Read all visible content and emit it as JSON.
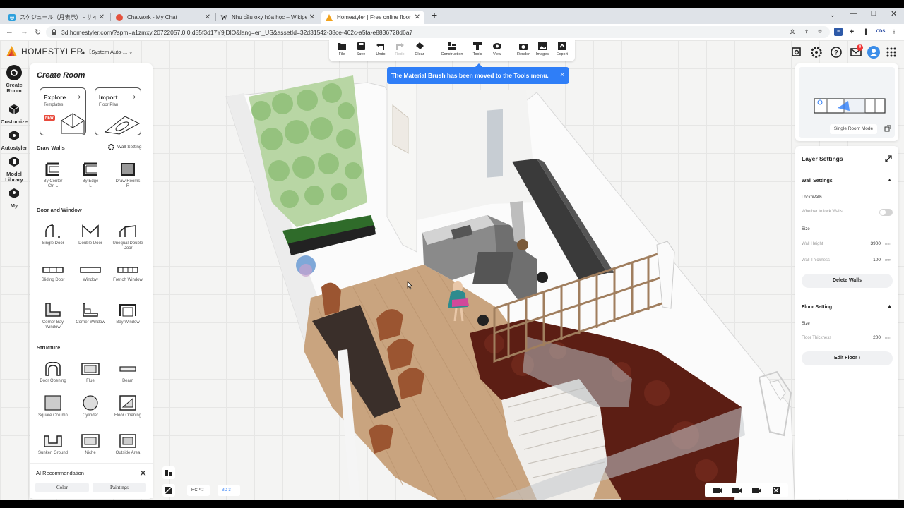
{
  "browser": {
    "tabs": [
      {
        "label": "スケジュール（月表示） - サイボウズ",
        "favicon_color": "#2ea0dc"
      },
      {
        "label": "Chatwork - My Chat",
        "favicon_color": "#e4503b"
      },
      {
        "label": "Nhu cầu oxy hóa học – Wikipedia",
        "favicon_color": "#ffffff"
      },
      {
        "label": "Homestyler | Free online floor pl",
        "favicon_color": "#f2a21b"
      }
    ],
    "url": "3d.homestyler.com/?spm=a1zmxy.20722057.0.0.d55f3d17Y9jDlO&lang=en_US&assetId=32d31542-38ce-462c-a5fa-e8836728d6a7",
    "ext_label": "CDS",
    "tab_close": "✕",
    "new_tab": "+"
  },
  "app": {
    "logo_text": "HOMESTYLER",
    "project_name": "【System Auto-...",
    "toolbar": [
      {
        "label": "File",
        "icon": "folder-icon"
      },
      {
        "label": "Save",
        "icon": "save-icon"
      },
      {
        "label": "Undo",
        "icon": "undo-icon"
      },
      {
        "label": "Redo",
        "icon": "redo-icon"
      },
      {
        "label": "Clear",
        "icon": "eraser-icon"
      },
      {
        "label": "Construction",
        "icon": "construction-icon"
      },
      {
        "label": "Tools",
        "icon": "tools-icon"
      },
      {
        "label": "View",
        "icon": "eye-icon"
      },
      {
        "label": "Render",
        "icon": "camera-icon"
      },
      {
        "label": "Images",
        "icon": "image-icon"
      },
      {
        "label": "Export",
        "icon": "export-icon"
      }
    ],
    "notification_badge": "9",
    "tooltip": "The Material Brush has been moved to the Tools menu.",
    "rail": [
      {
        "label": "Create Room"
      },
      {
        "label": "Customize"
      },
      {
        "label": "Autostyler"
      },
      {
        "label": "Model Library"
      },
      {
        "label": "My"
      }
    ],
    "panel": {
      "title": "Create Room",
      "cards": [
        {
          "title": "Explore",
          "subtitle": "Templates",
          "badge": "NEW"
        },
        {
          "title": "Import",
          "subtitle": "Floor Plan"
        }
      ],
      "draw_walls": "Draw Walls",
      "wall_setting": "Wall Setting",
      "walls": [
        {
          "label": "By Center",
          "shortcut": "Ctrl L"
        },
        {
          "label": "By Edge",
          "shortcut": "L"
        },
        {
          "label": "Draw Rooms",
          "shortcut": "R"
        }
      ],
      "door_window": "Door and Window",
      "doors": [
        {
          "label": "Single Door"
        },
        {
          "label": "Double Door"
        },
        {
          "label": "Unequal Double Door"
        },
        {
          "label": "Sliding Door"
        },
        {
          "label": "Window"
        },
        {
          "label": "French Window"
        },
        {
          "label": "Corner Bay Window"
        },
        {
          "label": "Corner Window"
        },
        {
          "label": "Bay Window"
        }
      ],
      "structure": "Structure",
      "structures": [
        {
          "label": "Door Opening"
        },
        {
          "label": "Flue"
        },
        {
          "label": "Beam"
        },
        {
          "label": "Square Column"
        },
        {
          "label": "Cylinder"
        },
        {
          "label": "Floor Opening"
        },
        {
          "label": "Sunken Ground"
        },
        {
          "label": "Niche"
        },
        {
          "label": "Outside Area"
        }
      ]
    },
    "ai": {
      "title": "AI Recommendation",
      "close": "✕",
      "buttons": [
        "Color",
        "Paintings"
      ]
    },
    "bottom": {
      "rcp": "RCP",
      "rcp_num": "2",
      "view3d": "3D",
      "view3d_num": "3"
    },
    "preview": {
      "mode": "Single Room Mode"
    },
    "layer": {
      "title": "Layer Settings",
      "wall_settings": "Wall Settings",
      "lock_walls": "Lock Walls",
      "whether_lock": "Whether to lock Walls",
      "size": "Size",
      "wall_height_label": "Wall Height",
      "wall_height": "3900",
      "wall_thickness_label": "Wall Thickness",
      "wall_thickness": "100",
      "unit": "mm",
      "delete_walls": "Delete Walls",
      "floor_setting": "Floor Setting",
      "floor_size": "Size",
      "floor_thickness_label": "Floor Thickness",
      "floor_thickness": "200",
      "edit_floor": "Edit Floor ›"
    }
  }
}
